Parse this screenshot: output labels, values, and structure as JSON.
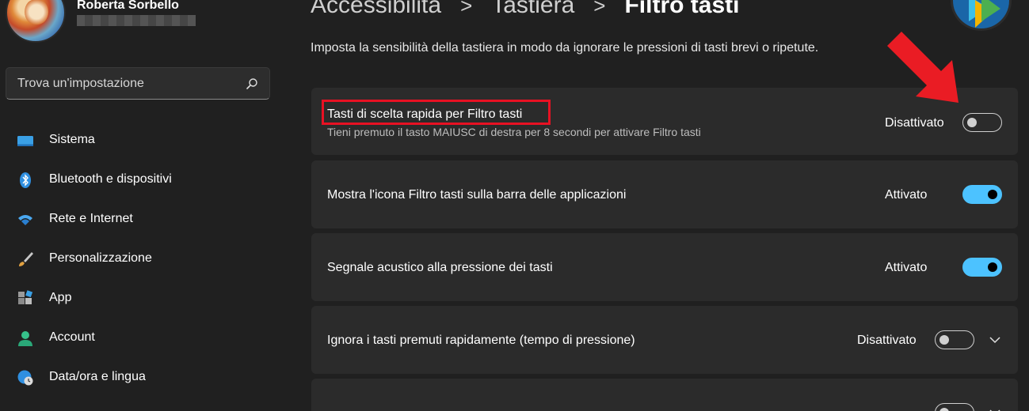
{
  "user": {
    "name": "Roberta Sorbello"
  },
  "search": {
    "placeholder": "Trova un'impostazione"
  },
  "nav": [
    {
      "label": "Sistema",
      "icon": "system-icon"
    },
    {
      "label": "Bluetooth e dispositivi",
      "icon": "bluetooth-icon"
    },
    {
      "label": "Rete e Internet",
      "icon": "wifi-icon"
    },
    {
      "label": "Personalizzazione",
      "icon": "brush-icon"
    },
    {
      "label": "App",
      "icon": "apps-icon"
    },
    {
      "label": "Account",
      "icon": "account-icon"
    },
    {
      "label": "Data/ora e lingua",
      "icon": "globe-clock-icon"
    }
  ],
  "breadcrumb": {
    "parent1": "Accessibilità",
    "parent2": "Tastiera",
    "current": "Filtro tasti",
    "separator": ">"
  },
  "description": "Imposta la sensibilità della tastiera in modo da ignorare le pressioni di tasti brevi o ripetute.",
  "settings": [
    {
      "title": "Tasti di scelta rapida per Filtro tasti",
      "subtitle": "Tieni premuto il tasto MAIUSC di destra per 8 secondi per attivare Filtro tasti",
      "state": "Disattivato",
      "on": false
    },
    {
      "title": "Mostra l'icona Filtro tasti sulla barra delle applicazioni",
      "state": "Attivato",
      "on": true
    },
    {
      "title": "Segnale acustico alla pressione dei tasti",
      "state": "Attivato",
      "on": true
    },
    {
      "title": "Ignora i tasti premuti rapidamente (tempo di pressione)",
      "state": "Disattivato",
      "on": false,
      "expandable": true
    }
  ],
  "colors": {
    "accent": "#4cc2ff",
    "background": "#202020",
    "card": "#2b2b2b",
    "highlight": "#e81123"
  }
}
